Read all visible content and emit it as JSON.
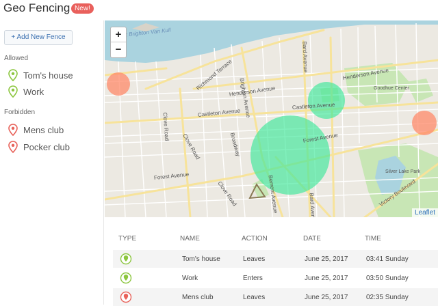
{
  "app": {
    "title": "Geo Fencing",
    "badge": "New!"
  },
  "sidebar": {
    "add_button": "+ Add New Fence",
    "allowed_label": "Allowed",
    "allowed": [
      {
        "label": "Tom's house"
      },
      {
        "label": "Work"
      }
    ],
    "forbidden_label": "Forbidden",
    "forbidden": [
      {
        "label": "Mens club"
      },
      {
        "label": "Pocker club"
      }
    ]
  },
  "map": {
    "zoom_in": "+",
    "zoom_out": "−",
    "attribution": "Leaflet",
    "labels": {
      "street1": "Richmond Terrace",
      "street2": "Brighton Avenue",
      "street3": "Bard Avenue",
      "street4": "Henderson Avenue",
      "street5": "Henderson Avenue",
      "street6": "Castleton Avenue",
      "street7": "Castleton Avenue",
      "street8": "Clove Road",
      "street9": "Clove Road",
      "street10": "Broadway",
      "street11": "Forest Avenue",
      "street12": "Forest Avenue",
      "street13": "Bement Avenue",
      "street14": "Bard Avenue",
      "street15": "Clove Road",
      "street16": "Victory Boulevard",
      "street17": "Goodhue Center",
      "street18": "Silver Lake Park",
      "water": "West Brighton Van Kull"
    },
    "colors": {
      "allowed_fence": "#3ee89a",
      "forbidden_fence": "#ff8a6a",
      "water": "#aad3df",
      "park": "#c8e6b5"
    }
  },
  "activity": {
    "headers": {
      "type": "TYPE",
      "name": "NAME",
      "action": "ACTION",
      "date": "DATE",
      "time": "TIME"
    },
    "rows": [
      {
        "kind": "allowed",
        "name": "Tom's house",
        "action": "Leaves",
        "date": "June 25, 2017",
        "time": "03:41 Sunday"
      },
      {
        "kind": "allowed",
        "name": "Work",
        "action": "Enters",
        "date": "June 25, 2017",
        "time": "03:50 Sunday"
      },
      {
        "kind": "forbidden",
        "name": "Mens club",
        "action": "Leaves",
        "date": "June 25, 2017",
        "time": "02:35 Sunday"
      }
    ]
  },
  "icons": {
    "allowed": "map-pin-green-icon",
    "forbidden": "map-pin-red-icon"
  }
}
